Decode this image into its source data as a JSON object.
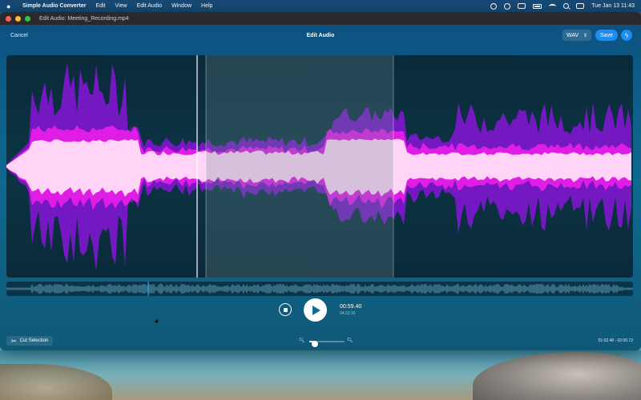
{
  "menubar": {
    "app_name": "Simple Audio Converter",
    "items": [
      "Edit",
      "View",
      "Edit Audio",
      "Window",
      "Help"
    ],
    "clock": "Tue Jan 13  11:43"
  },
  "window": {
    "title": "Edit Audio: Meeting_Recording.mp4"
  },
  "toolbar": {
    "cancel_label": "Cancel",
    "title": "Edit Audio",
    "format": "WAV",
    "save_label": "Save"
  },
  "playback": {
    "current_time": "00:59.40",
    "total_time": "04:22.30"
  },
  "bottom": {
    "cut_label": "Cut Selection",
    "selection_range": "01:02.48 - 02:00.72",
    "zoom_level": 0.15
  },
  "colors": {
    "accent": "#1f8cf0",
    "wave_outer": "#8a1ad0",
    "wave_mid": "#e020e8",
    "wave_inner": "#ffd0f4"
  }
}
